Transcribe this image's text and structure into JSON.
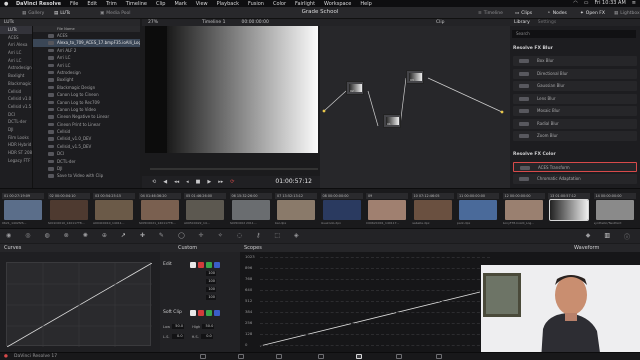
{
  "menubar": {
    "apple": "",
    "app": "DaVinci Resolve",
    "items": [
      "File",
      "Edit",
      "Trim",
      "Timeline",
      "Clip",
      "Mark",
      "View",
      "Playback",
      "Fusion",
      "Color",
      "Fairlight",
      "Workspace",
      "Help"
    ],
    "time": "Fri 10:33 AM"
  },
  "toolbar": {
    "gallery": "Gallery",
    "luts": "LUTs",
    "media_pool": "Media Pool",
    "project": "Grade School",
    "timeline": "Timeline",
    "clips": "Clips",
    "nodes": "Nodes",
    "open_fx": "Open FX",
    "lightbox": "Lightbox"
  },
  "luts_panel": {
    "title": "LUTs",
    "categories": [
      "LUTs",
      "ACES",
      "Arri Alexa",
      "Arri LC",
      "Arri LC",
      "Astrodesign",
      "Boxlight",
      "Blackmagic Design",
      "Cellsid",
      "Cellsid v1.0",
      "Cellsid v1.5",
      "DCI",
      "DCTL-der",
      "DJI",
      "Film Looks",
      "HDR Hybrid",
      "HDR ST 2084",
      "Legacy FTF"
    ],
    "selected_category": 0,
    "files_header": "File Name",
    "files": [
      "ACES",
      "Alexa_to_709_ACES_17.bmpF35.ioAlli_Log",
      "Arri ALF 2",
      "Arri LC",
      "Arri LC",
      "Astrodesign",
      "Boxlight",
      "Blackmagic Design",
      "Canon Log to Cineon",
      "Canon Log to Rec709",
      "Canon Log to Video",
      "Cineon Negative to Linear",
      "Cineon Print to Linear",
      "Cellsid",
      "Cellsid_v1.0_DEV",
      "Cellsid_v1.5_DEV",
      "DCI",
      "DCTL-der",
      "DJI",
      "Save to Video with Clip"
    ],
    "selected_file": 1
  },
  "viewer": {
    "zoom": "27%",
    "timeline": "Timeline 1",
    "timecode_top": "00:00:00:00",
    "clip_label": "Clip",
    "timecode": "01:00:57:12"
  },
  "nodes": {
    "labels": [
      "02",
      "03",
      "01",
      "04"
    ]
  },
  "library": {
    "tab_library": "Library",
    "tab_settings": "Settings",
    "search": "Search",
    "group_blur": "Resolve FX Blur",
    "blur_items": [
      "Box Blur",
      "Directional Blur",
      "Gaussian Blur",
      "Lens Blur",
      "Mosaic Blur",
      "Radial Blur",
      "Zoom Blur"
    ],
    "group_color": "Resolve FX Color",
    "color_items": [
      "ACES Transform",
      "Chromatic Adaptation"
    ],
    "selected_color_item": 0
  },
  "clips": [
    {
      "num": "01",
      "tc": "00:27:19:09",
      "name": "0621_1402f2S...",
      "color": "#5b6e8a"
    },
    {
      "num": "02",
      "tc": "00:00:04:10",
      "name": "A001C0010_140117T8...",
      "color": "#4e3a30"
    },
    {
      "num": "03",
      "tc": "00:54:25:15",
      "name": "A004C0010_14011...",
      "color": "#6b5a48"
    },
    {
      "num": "04",
      "tc": "01:46:36:20",
      "name": "A005C0021_140117T8...",
      "color": "#7a6050"
    },
    {
      "num": "05",
      "tc": "01:46:26:00",
      "name": "A005C0022_14...",
      "color": "#5c5850"
    },
    {
      "num": "06",
      "tc": "15:32:26:00",
      "name": "A005C002 2011...",
      "color": "#6a6d70"
    },
    {
      "num": "07",
      "tc": "13:52:13:12",
      "name": "bar.dpx",
      "color": "#8a7a6a"
    },
    {
      "num": "08",
      "tc": "00:00:00:00",
      "name": "blueknob.dpx",
      "color": "#2a3a60"
    },
    {
      "num": "09",
      "tc": "",
      "name": "C0062C001_140117...",
      "color": "#a08070"
    },
    {
      "num": "10",
      "tc": "07:12:46:05",
      "name": "isabella.dpx",
      "color": "#6a5040"
    },
    {
      "num": "11",
      "tc": "00:00:00:00",
      "name": "park.dpx",
      "color": "#4a6a9a"
    },
    {
      "num": "12",
      "tc": "00:00:00:00",
      "name": "SonyF35.lioAlli_Log...",
      "color": "#9a8070"
    },
    {
      "num": "13",
      "tc": "01:00:57:12",
      "name": "",
      "color": "#888"
    },
    {
      "num": "14",
      "tc": "00:00:00:00",
      "name": "synthetic/TwoPoint",
      "color": "#8a8a8a"
    }
  ],
  "selected_clip": 12,
  "curves": {
    "title": "Curves"
  },
  "edit": {
    "title": "Edit",
    "custom": "Custom",
    "values": [
      "100",
      "100",
      "100",
      "100"
    ],
    "soft_clip": "Soft Clip",
    "low": "Low",
    "low_val": "50.0",
    "high": "High",
    "high_val": "50.0",
    "ls": "L.S.",
    "ls_val": "0.0",
    "hs": "H.S.",
    "hs_val": "0.0"
  },
  "scopes": {
    "title": "Scopes",
    "mode": "Waveform",
    "levels": [
      "1023",
      "896",
      "768",
      "640",
      "512",
      "384",
      "256",
      "128",
      "0"
    ]
  },
  "bottom": {
    "app": "DaVinci Resolve 17"
  }
}
